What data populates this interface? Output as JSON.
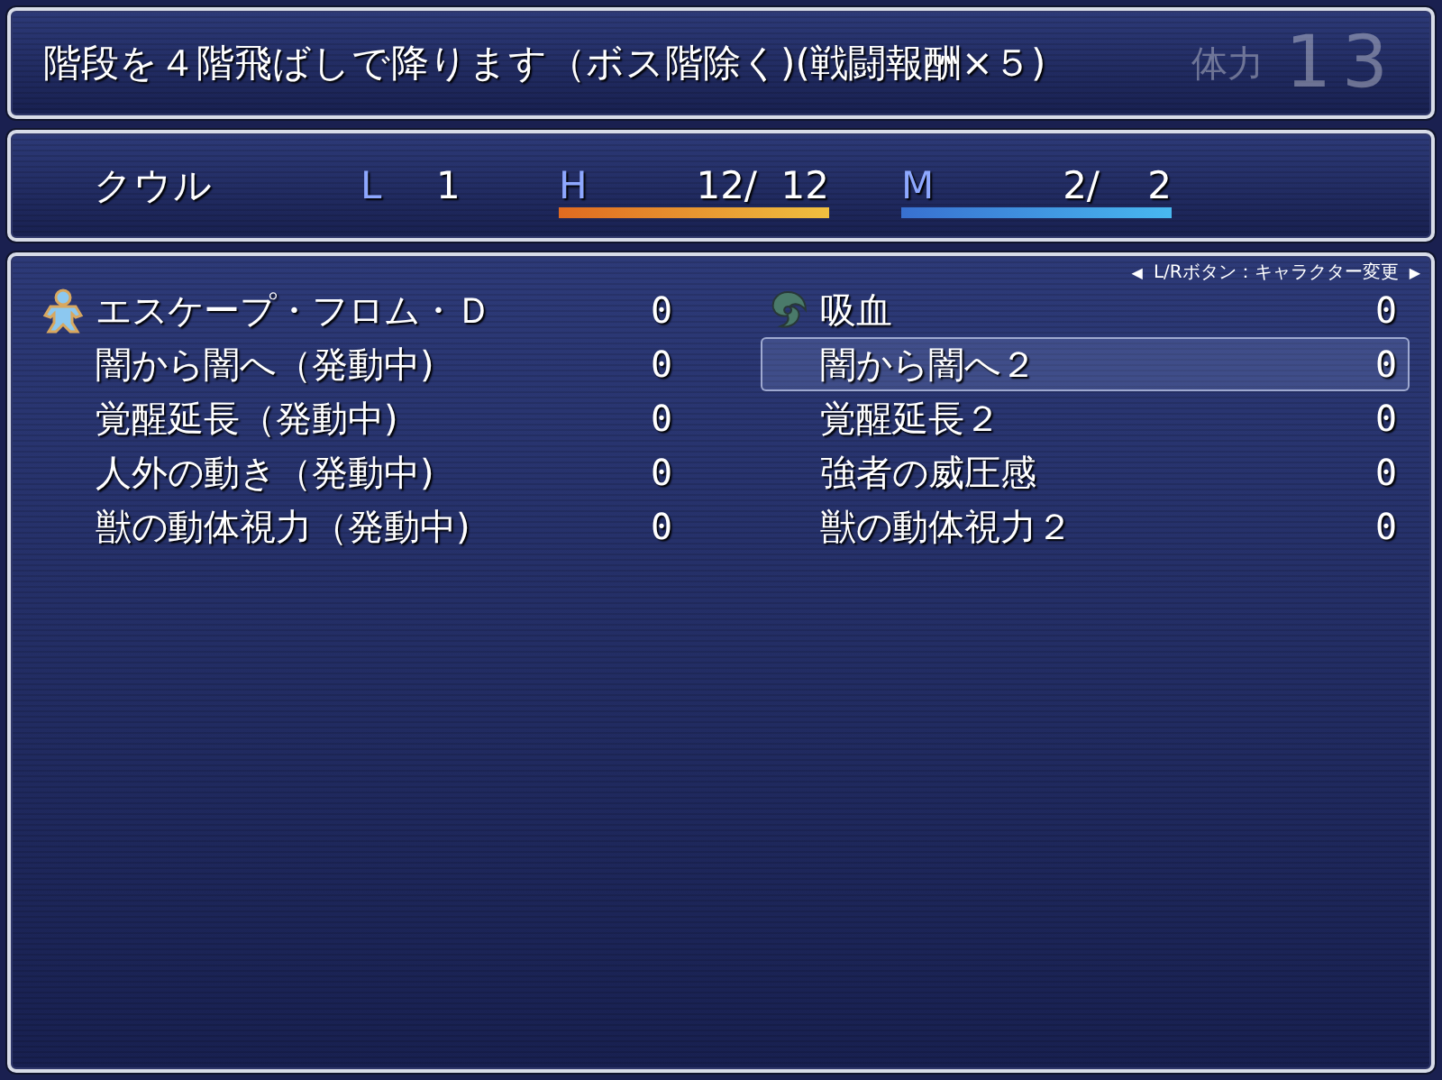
{
  "help": {
    "text": "階段を４階飛ばしで降ります（ボス階除く)(戦闘報酬×５)",
    "backdrop_label": "体力",
    "backdrop_value": "13"
  },
  "status": {
    "name": "クウル",
    "level_label": "L",
    "level": "1",
    "gauges": [
      {
        "kind": "hp",
        "label": "H",
        "current": "12/",
        "max": "12",
        "level": 1
      },
      {
        "kind": "mp",
        "label": "M",
        "current": "2/",
        "max": "2",
        "level": 1
      }
    ]
  },
  "skills": {
    "hint_left": "◀",
    "hint": "L/Rボタン：キャラクター変更",
    "hint_right": "▶",
    "items": [
      {
        "name": "エスケープ・フロム・Ｄ",
        "cost": "0",
        "kind": "figure",
        "selected": false
      },
      {
        "name": "吸血",
        "cost": "0",
        "kind": "swirl",
        "selected": false
      },
      {
        "name": "闇から闇へ（発動中)",
        "cost": "0",
        "selected": false
      },
      {
        "name": "闇から闇へ２",
        "cost": "0",
        "selected": true
      },
      {
        "name": "覚醒延長（発動中)",
        "cost": "0",
        "selected": false
      },
      {
        "name": "覚醒延長２",
        "cost": "0",
        "selected": false
      },
      {
        "name": "人外の動き（発動中)",
        "cost": "0",
        "selected": false
      },
      {
        "name": "強者の威圧感",
        "cost": "0",
        "selected": false
      },
      {
        "name": "獣の動体視力（発動中)",
        "cost": "0",
        "selected": false
      },
      {
        "name": "獣の動体視力２",
        "cost": "0",
        "selected": false
      }
    ]
  }
}
